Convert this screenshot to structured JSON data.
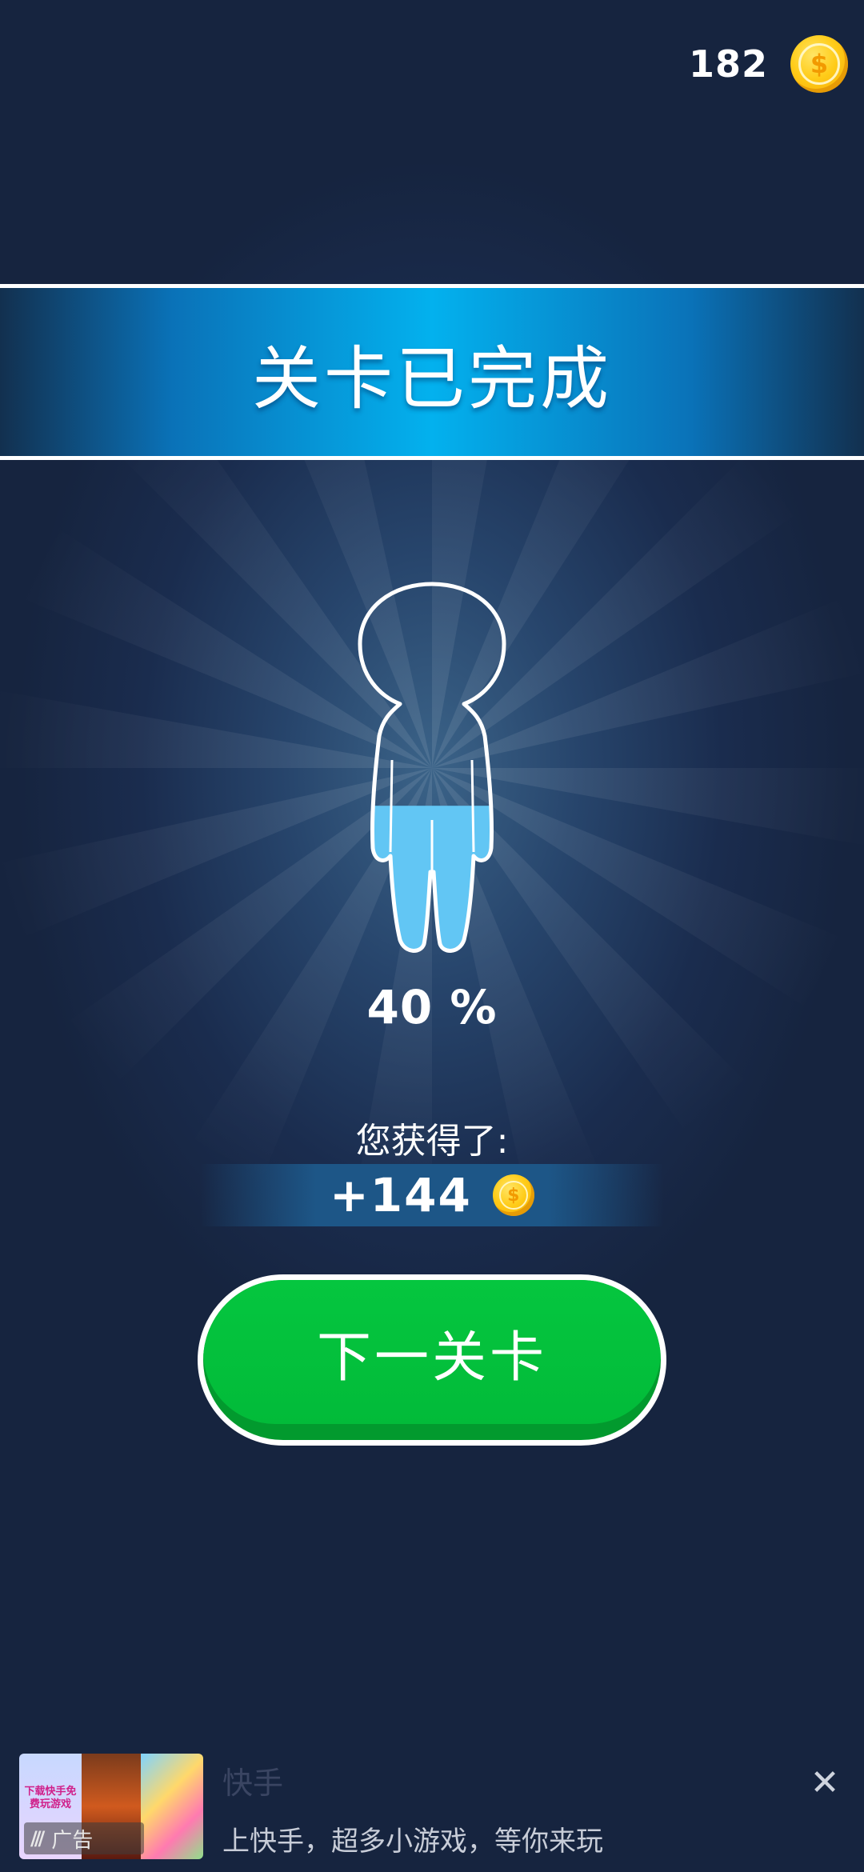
{
  "hud": {
    "coins": "182",
    "coin_icon": "coin-icon"
  },
  "banner": {
    "title": "关卡已完成"
  },
  "progress": {
    "percent_label": "40 %",
    "fill_fraction": 0.4,
    "fill_color": "#62c6f4"
  },
  "reward": {
    "label": "您获得了:",
    "amount": "+144"
  },
  "next_button": {
    "label": "下一关卡",
    "color": "#02bb39"
  },
  "ad": {
    "app_name": "快手",
    "description": "上快手，超多小游戏，等你来玩",
    "badge_label": "广告",
    "thumb_text": "下载快手免费玩游戏"
  },
  "colors": {
    "background": "#16243f",
    "banner_accent": "#03b1ee",
    "coin": "#ffcc19"
  }
}
